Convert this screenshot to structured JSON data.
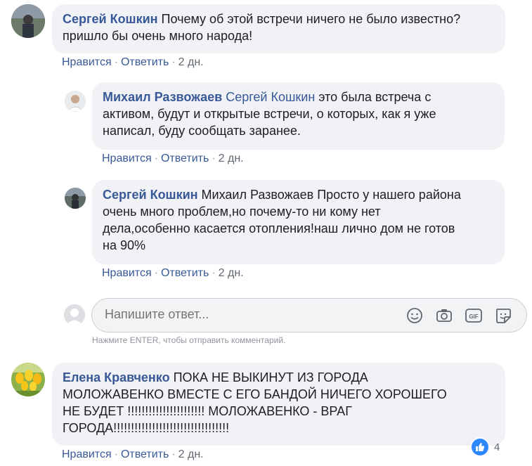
{
  "comments": [
    {
      "author": "Сергей Кошкин",
      "lines": [
        "Почему об этой встречи ничего не было известно?",
        "пришло бы очень много народа!"
      ],
      "like": "Нравится",
      "reply": "Ответить",
      "time": "2 дн."
    },
    {
      "author": "Михаил Развожаев",
      "mention": "Сергей Кошкин",
      "lines": [
        "это была встреча с",
        "активом, будут и открытые встречи, о которых, как я уже",
        "написал, буду сообщать заранее."
      ],
      "like": "Нравится",
      "reply": "Ответить",
      "time": "2 дн."
    },
    {
      "author": "Сергей Кошкин",
      "lines": [
        "Михаил Развожаев Просто у нашего района",
        "очень много проблем,но почему-то ни кому нет",
        "дела,особенно касается отопления!наш лично дом не готов",
        "на 90%"
      ],
      "like": "Нравится",
      "reply": "Ответить",
      "time": "2 дн."
    },
    {
      "author": "Елена Кравченко",
      "lines": [
        "ПОКА НЕ ВЫКИНУТ ИЗ ГОРОДА",
        "МОЛОЖАВЕНКО ВМЕСТЕ С ЕГО БАНДОЙ НИЧЕГО ХОРОШЕГО",
        "НЕ БУДЕТ !!!!!!!!!!!!!!!!!!!!!! МОЛОЖАВЕНКО - ВРАГ",
        "ГОРОДА!!!!!!!!!!!!!!!!!!!!!!!!!!!!!!!!!"
      ],
      "like": "Нравится",
      "reply": "Ответить",
      "time": "2 дн.",
      "reaction_count": "4"
    }
  ],
  "reply_box": {
    "placeholder": "Напишите ответ...",
    "hint": "Нажмите ENTER, чтобы отправить комментарий.",
    "icons": [
      "emoji-icon",
      "camera-icon",
      "gif-icon",
      "sticker-icon"
    ]
  },
  "colors": {
    "link": "#385898",
    "bubble": "#f0f2f5",
    "like_blue": "#2d88ff"
  }
}
